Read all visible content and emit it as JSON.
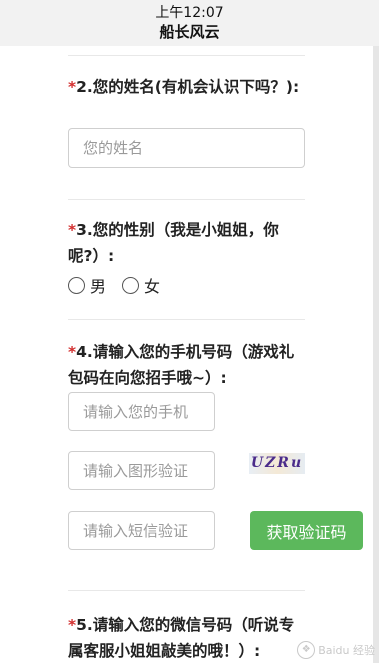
{
  "status_bar": {
    "time": "上午12:07",
    "title": "船长风云"
  },
  "questions": {
    "q2": {
      "required_mark": "*",
      "label": "2.您的姓名(有机会认识下吗？):",
      "name_placeholder": "您的姓名"
    },
    "q3": {
      "required_mark": "*",
      "label": "3.您的性别（我是小姐姐，你呢?）:",
      "options": [
        {
          "label": "男"
        },
        {
          "label": "女"
        }
      ]
    },
    "q4": {
      "required_mark": "*",
      "label": "4.请输入您的手机号码（游戏礼包码在向您招手哦~）:",
      "phone_placeholder": "请输入您的手机",
      "captcha_placeholder": "请输入图形验证",
      "captcha_text": "UZRu",
      "sms_placeholder": "请输入短信验证",
      "sms_button_label": "获取验证码"
    },
    "q5": {
      "required_mark": "*",
      "label": "5.请输入您的微信号码（听说专属客服小姐姐敲美的哦！）:"
    }
  },
  "watermark": {
    "text": "Baidu 经验",
    "url": "jingyan.baidu.com"
  },
  "colors": {
    "required": "#d32f2f",
    "button": "#5cb85c"
  }
}
